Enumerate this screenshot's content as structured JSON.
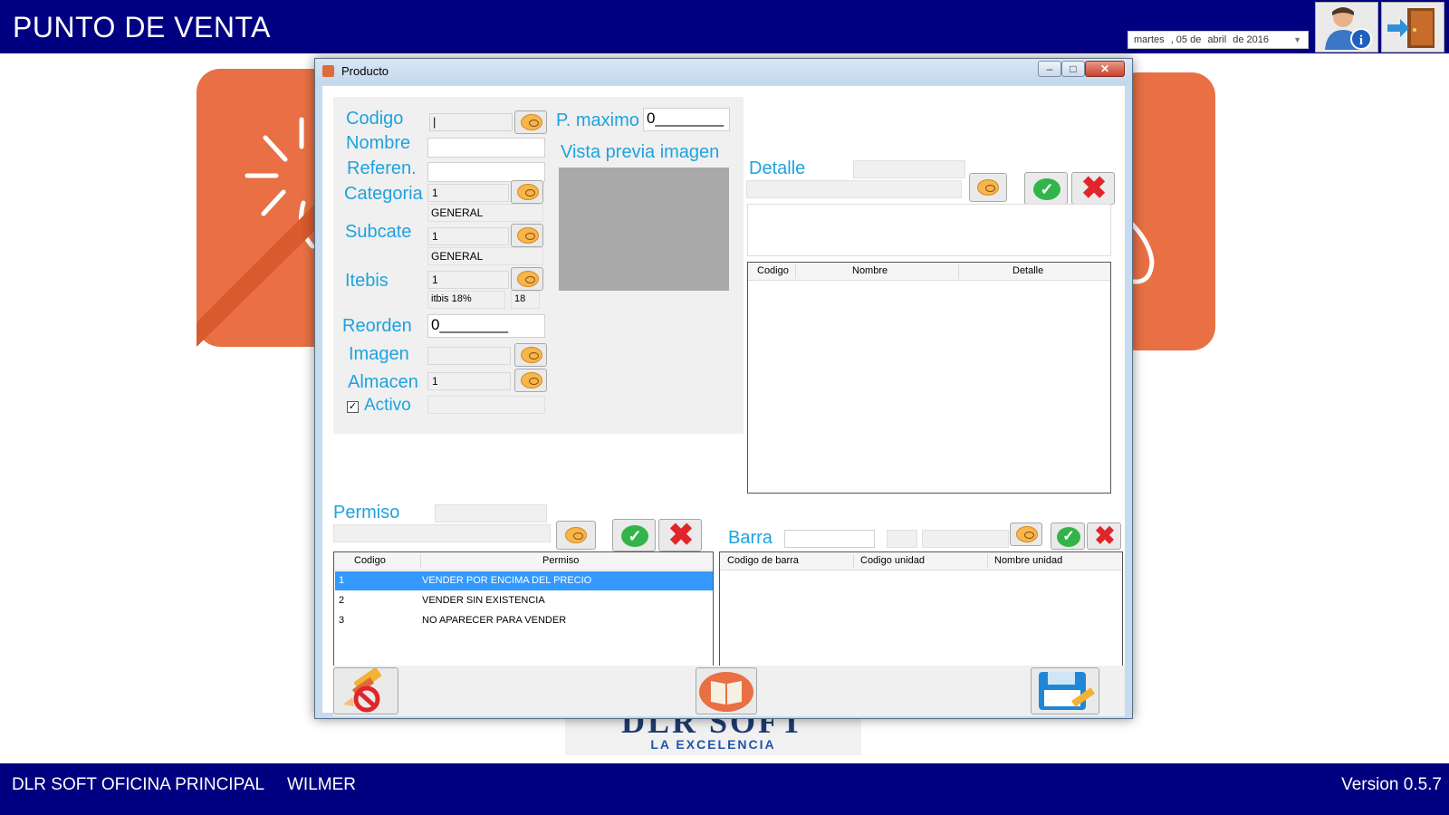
{
  "app": {
    "title": "PUNTO DE VENTA",
    "date": {
      "weekday": "martes",
      "day": ", 05 de",
      "month": "abril",
      "year": "de 2016"
    },
    "icons": {
      "user_info": "user-info-icon",
      "exit": "exit-door-icon"
    },
    "colors": {
      "bar": "#000080",
      "accent": "#1fa2df",
      "tile": "#e87044",
      "selection": "#3399ff"
    }
  },
  "logo": {
    "main": "DLR SOFT",
    "sub": "LA EXCELENCIA"
  },
  "statusbar": {
    "branch": "DLR SOFT OFICINA PRINCIPAL",
    "user": "WILMER",
    "version": "Version 0.5.7"
  },
  "dialog": {
    "title": "Producto",
    "form": {
      "codigo_label": "Codigo",
      "codigo_value": "|",
      "nombre_label": "Nombre",
      "nombre_value": "",
      "referen_label": "Referen.",
      "referen_value": "",
      "categoria_label": "Categoria",
      "categoria_id": "1",
      "categoria_name": "GENERAL",
      "subcate_label": "Subcate",
      "subcate_id": "1",
      "subcate_name": "GENERAL",
      "itebis_label": "Itebis",
      "itebis_id": "1",
      "itebis_name": "itbis 18%",
      "itebis_rate": "18",
      "reorden_label": "Reorden",
      "reorden_value": "0________",
      "imagen_label": "Imagen",
      "imagen_value": "",
      "almacen_label": "Almacen",
      "almacen_value": "1",
      "activo_label": "Activo",
      "activo_checked": "✓",
      "pmaximo_label": "P. maximo",
      "pmaximo_value": "0________",
      "preview_label": "Vista previa imagen"
    },
    "detalle": {
      "label": "Detalle",
      "columns": [
        "Codigo",
        "Nombre",
        "Detalle"
      ],
      "rows": []
    },
    "permiso": {
      "label": "Permiso",
      "columns": [
        "Codigo",
        "Permiso"
      ],
      "rows": [
        {
          "codigo": "1",
          "permiso": "VENDER POR ENCIMA DEL PRECIO",
          "selected": true
        },
        {
          "codigo": "2",
          "permiso": "VENDER SIN EXISTENCIA",
          "selected": false
        },
        {
          "codigo": "3",
          "permiso": "NO APARECER PARA VENDER",
          "selected": false
        }
      ]
    },
    "barra": {
      "label": "Barra",
      "columns": [
        "Codigo de barra",
        "Codigo unidad",
        "Nombre unidad"
      ],
      "rows": []
    },
    "buttons": {
      "clear": "clear-pencil-icon",
      "book": "open-book-icon",
      "save": "save-disk-icon",
      "search": "search-bubble-icon",
      "accept": "check-icon",
      "cancel": "x-icon"
    }
  }
}
